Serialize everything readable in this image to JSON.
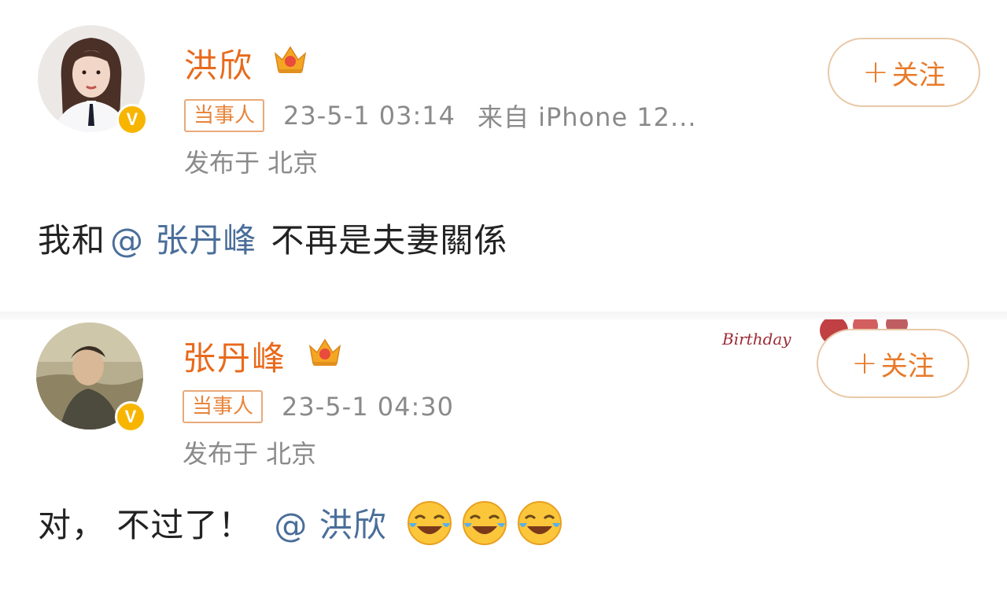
{
  "posts": [
    {
      "username": "洪欣",
      "follow_label": "关注",
      "role_badge": "当事人",
      "timestamp": "23-5-1 03:14",
      "source": "来自 iPhone 12...",
      "location": "发布于 北京",
      "text_before": "我和",
      "mention": "@ 张丹峰",
      "text_after": "不再是夫妻關係"
    },
    {
      "username": "张丹峰",
      "follow_label": "关注",
      "role_badge": "当事人",
      "timestamp": "23-5-1 04:30",
      "location": "发布于 北京",
      "text_before": "对， 不过了！",
      "mention": "@ 洪欣",
      "emojis": [
        "laughing-crying",
        "laughing-crying",
        "laughing-crying"
      ]
    }
  ],
  "decoration": {
    "birthday_text": "Birthday"
  },
  "colors": {
    "username": "#e86a1c",
    "follow_border": "#e8c9a8",
    "mention": "#4a6e9a",
    "meta": "#8a8a8a",
    "verified": "#f7b500"
  }
}
